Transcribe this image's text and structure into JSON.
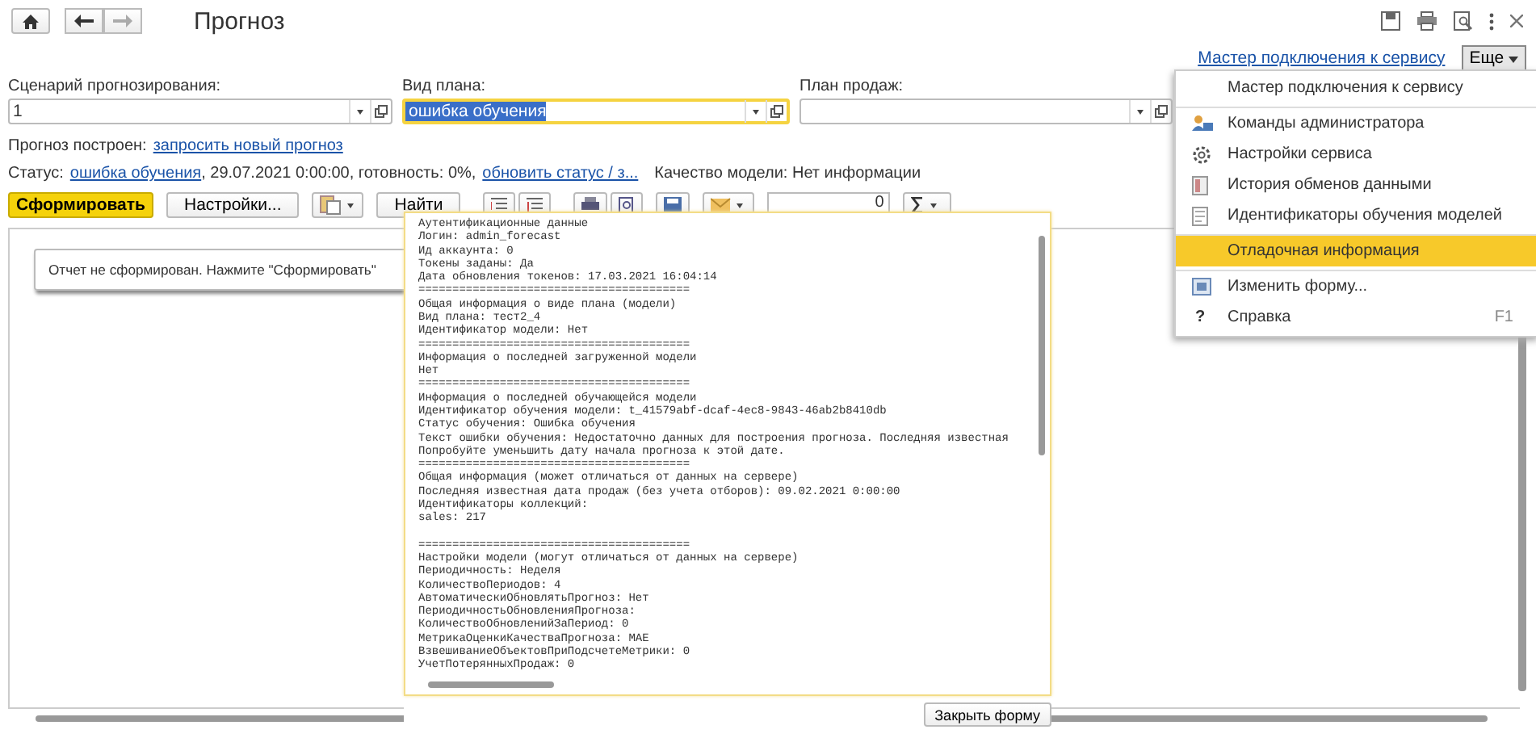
{
  "window": {
    "title": "Прогноз"
  },
  "header": {
    "link": "Мастер подключения к сервису",
    "more_button": "Еще"
  },
  "fields": [
    {
      "label": "Сценарий прогнозирования:",
      "value": "1",
      "focused": false
    },
    {
      "label": "Вид плана:",
      "value": "ошибка обучения",
      "focused": true
    },
    {
      "label": "План продаж:",
      "focused": false
    }
  ],
  "forecast_line": {
    "label": "Прогноз построен:",
    "link": "запросить новый прогноз"
  },
  "status_line": {
    "label": "Статус:",
    "status_link": "ошибка обучения",
    "details": ", 29.07.2021 0:00:00, готовность: 0%,",
    "refresh_link": "обновить статус / з...",
    "quality": "Качество модели: Нет информации"
  },
  "toolbar": {
    "generate_button": "Сформировать",
    "settings_button": "Настройки...",
    "find_button": "Найти",
    "number_field": "0"
  },
  "report": {
    "message": "Отчет не сформирован. Нажмите \"Сформировать\""
  },
  "debug_form": {
    "text": "Аутентификационные данные\nЛогин: admin_forecast\nИд аккаунта: 0\nТокены заданы: Да\nДата обновления токенов: 17.03.2021 16:04:14\n========================================\nОбщая информация о виде плана (модели)\nВид плана: тест2_4\nИдентификатор модели: Нет\n========================================\nИнформация о последней загруженной модели\nНет\n========================================\nИнформация о последней обучающейся модели\nИдентификатор обучения модели: t_41579abf-dcaf-4ec8-9843-46ab2b8410db\nСтатус обучения: Ошибка обучения\nТекст ошибки обучения: Недостаточно данных для построения прогноза. Последняя известная\nПопробуйте уменьшить дату начала прогноза к этой дате.\n========================================\nОбщая информация (может отличаться от данных на сервере)\nПоследняя известная дата продаж (без учета отборов): 09.02.2021 0:00:00\nИдентификаторы коллекций:\nsales: 217\n\n========================================\nНастройки модели (могут отличаться от данных на сервере)\nПериодичность: Неделя\nКоличествоПериодов: 4\nАвтоматическиОбновлятьПрогноз: Нет\nПериодичностьОбновленияПрогноза:\nКоличествоОбновленийЗаПериод: 0\nМетрикаОценкиКачестваПрогноза: MAE\nВзвешиваниеОбъектовПриПодсчетеМетрики: 0\nУчетПотерянныхПродаж: 0",
    "close_button": "Закрыть форму"
  },
  "menu": [
    {
      "label": "Мастер подключения к сервису",
      "selected": false,
      "separator_before": false
    },
    {
      "label": "Команды администратора",
      "kind": "users",
      "selected": false,
      "separator_before": true
    },
    {
      "label": "Настройки сервиса",
      "kind": "gear",
      "selected": false,
      "separator_before": false
    },
    {
      "label": "История обменов данными",
      "kind": "list",
      "selected": false,
      "separator_before": false
    },
    {
      "label": "Идентификаторы обучения моделей",
      "kind": "doc",
      "selected": false,
      "separator_before": false
    },
    {
      "label": "Отладочная информация",
      "selected": true,
      "separator_before": true
    },
    {
      "label": "Изменить форму...",
      "kind": "form",
      "selected": false,
      "separator_before": true
    },
    {
      "label": "Справка",
      "glyph": "?",
      "shortcut": "F1",
      "selected": false,
      "separator_before": false
    }
  ]
}
